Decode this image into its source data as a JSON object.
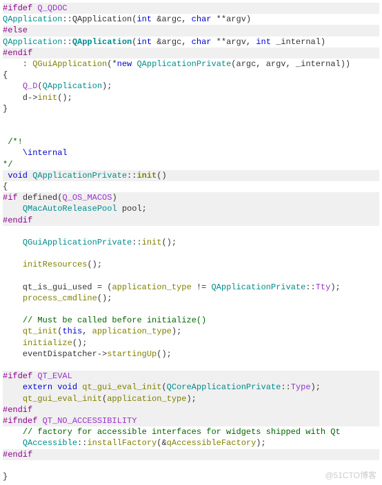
{
  "watermark": "@51CTO博客",
  "lines": [
    {
      "hl": true,
      "tokens": [
        {
          "t": "#ifdef ",
          "c": "kw-pre"
        },
        {
          "t": "Q_QDOC",
          "c": "kw-purple"
        }
      ]
    },
    {
      "tokens": [
        {
          "t": "QApplication",
          "c": "kw-teal"
        },
        {
          "t": "::"
        },
        {
          "t": "QApplication"
        },
        {
          "t": "("
        },
        {
          "t": "int",
          "c": "kw-blue"
        },
        {
          "t": " &argc, "
        },
        {
          "t": "char",
          "c": "kw-blue"
        },
        {
          "t": " **argv)"
        }
      ]
    },
    {
      "hl": true,
      "tokens": [
        {
          "t": "#else",
          "c": "kw-pre"
        }
      ]
    },
    {
      "tokens": [
        {
          "t": "QApplication",
          "c": "kw-teal"
        },
        {
          "t": "::"
        },
        {
          "t": "QApplication",
          "c": "kw-teal kw-bold"
        },
        {
          "t": "("
        },
        {
          "t": "int",
          "c": "kw-blue"
        },
        {
          "t": " &argc, "
        },
        {
          "t": "char",
          "c": "kw-blue"
        },
        {
          "t": " **argv, "
        },
        {
          "t": "int",
          "c": "kw-blue"
        },
        {
          "t": " _internal)"
        }
      ]
    },
    {
      "hl": true,
      "tokens": [
        {
          "t": "#endif",
          "c": "kw-pre"
        }
      ]
    },
    {
      "tokens": [
        {
          "t": "    : "
        },
        {
          "t": "QGuiApplication",
          "c": "kw-olive"
        },
        {
          "t": "(*"
        },
        {
          "t": "new",
          "c": "kw-blue"
        },
        {
          "t": " "
        },
        {
          "t": "QApplicationPrivate",
          "c": "kw-teal"
        },
        {
          "t": "(argc, argv, _internal))"
        }
      ]
    },
    {
      "tokens": [
        {
          "t": "{"
        }
      ]
    },
    {
      "tokens": [
        {
          "t": "    "
        },
        {
          "t": "Q_D",
          "c": "kw-purple"
        },
        {
          "t": "("
        },
        {
          "t": "QApplication",
          "c": "kw-teal"
        },
        {
          "t": ");"
        }
      ]
    },
    {
      "tokens": [
        {
          "t": "    d->"
        },
        {
          "t": "init",
          "c": "kw-olive"
        },
        {
          "t": "();"
        }
      ]
    },
    {
      "tokens": [
        {
          "t": "}"
        }
      ]
    },
    {
      "tokens": [
        {
          "t": " "
        }
      ]
    },
    {
      "tokens": [
        {
          "t": " "
        }
      ]
    },
    {
      "tokens": [
        {
          "t": " /*!",
          "c": "kw-green"
        }
      ]
    },
    {
      "tokens": [
        {
          "t": "    \\internal",
          "c": "kw-blue"
        }
      ]
    },
    {
      "tokens": [
        {
          "t": "*/",
          "c": "kw-green"
        }
      ]
    },
    {
      "hl": true,
      "tokens": [
        {
          "t": " "
        },
        {
          "t": "void",
          "c": "kw-blue"
        },
        {
          "t": " "
        },
        {
          "t": "QApplicationPrivate",
          "c": "kw-teal"
        },
        {
          "t": "::"
        },
        {
          "t": "init",
          "c": "kw-olive kw-bold"
        },
        {
          "t": "()"
        }
      ]
    },
    {
      "tokens": [
        {
          "t": "{"
        }
      ]
    },
    {
      "hl": true,
      "tokens": [
        {
          "t": "#if",
          "c": "kw-pre"
        },
        {
          "t": " "
        },
        {
          "t": "defined"
        },
        {
          "t": "("
        },
        {
          "t": "Q_OS_MACOS",
          "c": "kw-purple"
        },
        {
          "t": ")"
        }
      ]
    },
    {
      "hl": true,
      "tokens": [
        {
          "t": "    "
        },
        {
          "t": "QMacAutoReleasePool",
          "c": "kw-teal"
        },
        {
          "t": " pool;"
        }
      ]
    },
    {
      "hl": true,
      "tokens": [
        {
          "t": "#endif",
          "c": "kw-pre"
        }
      ]
    },
    {
      "tokens": [
        {
          "t": " "
        }
      ]
    },
    {
      "tokens": [
        {
          "t": "    "
        },
        {
          "t": "QGuiApplicationPrivate",
          "c": "kw-teal"
        },
        {
          "t": "::"
        },
        {
          "t": "init",
          "c": "kw-olive"
        },
        {
          "t": "();"
        }
      ]
    },
    {
      "tokens": [
        {
          "t": " "
        }
      ]
    },
    {
      "tokens": [
        {
          "t": "    "
        },
        {
          "t": "initResources",
          "c": "kw-olive"
        },
        {
          "t": "();"
        }
      ]
    },
    {
      "tokens": [
        {
          "t": " "
        }
      ]
    },
    {
      "tokens": [
        {
          "t": "    qt_is_gui_used = ("
        },
        {
          "t": "application_type",
          "c": "kw-olive"
        },
        {
          "t": " != "
        },
        {
          "t": "QApplicationPrivate",
          "c": "kw-teal"
        },
        {
          "t": "::"
        },
        {
          "t": "Tty",
          "c": "kw-purple"
        },
        {
          "t": ");"
        }
      ]
    },
    {
      "tokens": [
        {
          "t": "    "
        },
        {
          "t": "process_cmdline",
          "c": "kw-olive"
        },
        {
          "t": "();"
        }
      ]
    },
    {
      "tokens": [
        {
          "t": " "
        }
      ]
    },
    {
      "tokens": [
        {
          "t": "    "
        },
        {
          "t": "// Must be called before initialize()",
          "c": "kw-green"
        }
      ]
    },
    {
      "tokens": [
        {
          "t": "    "
        },
        {
          "t": "qt_init",
          "c": "kw-olive"
        },
        {
          "t": "("
        },
        {
          "t": "this",
          "c": "kw-blue"
        },
        {
          "t": ", "
        },
        {
          "t": "application_type",
          "c": "kw-olive"
        },
        {
          "t": ");"
        }
      ]
    },
    {
      "tokens": [
        {
          "t": "    "
        },
        {
          "t": "initialize",
          "c": "kw-olive"
        },
        {
          "t": "();"
        }
      ]
    },
    {
      "tokens": [
        {
          "t": "    eventDispatcher->"
        },
        {
          "t": "startingUp",
          "c": "kw-olive"
        },
        {
          "t": "();"
        }
      ]
    },
    {
      "tokens": [
        {
          "t": " "
        }
      ]
    },
    {
      "hl": true,
      "tokens": [
        {
          "t": "#ifdef ",
          "c": "kw-pre"
        },
        {
          "t": "QT_EVAL",
          "c": "kw-purple"
        }
      ]
    },
    {
      "hl": true,
      "tokens": [
        {
          "t": "    "
        },
        {
          "t": "extern",
          "c": "kw-blue"
        },
        {
          "t": " "
        },
        {
          "t": "void",
          "c": "kw-blue"
        },
        {
          "t": " "
        },
        {
          "t": "qt_gui_eval_init",
          "c": "kw-olive"
        },
        {
          "t": "("
        },
        {
          "t": "QCoreApplicationPrivate",
          "c": "kw-teal"
        },
        {
          "t": "::"
        },
        {
          "t": "Type",
          "c": "kw-purple"
        },
        {
          "t": ");"
        }
      ]
    },
    {
      "hl": true,
      "tokens": [
        {
          "t": "    "
        },
        {
          "t": "qt_gui_eval_init",
          "c": "kw-olive"
        },
        {
          "t": "("
        },
        {
          "t": "application_type",
          "c": "kw-olive"
        },
        {
          "t": ");"
        }
      ]
    },
    {
      "hl": true,
      "tokens": [
        {
          "t": "#endif",
          "c": "kw-pre"
        }
      ]
    },
    {
      "hl": true,
      "tokens": [
        {
          "t": "#ifndef ",
          "c": "kw-pre"
        },
        {
          "t": "QT_NO_ACCESSIBILITY",
          "c": "kw-purple"
        }
      ]
    },
    {
      "tokens": [
        {
          "t": "    "
        },
        {
          "t": "// factory for accessible interfaces for widgets shipped with Qt",
          "c": "kw-green"
        }
      ]
    },
    {
      "tokens": [
        {
          "t": "    "
        },
        {
          "t": "QAccessible",
          "c": "kw-teal"
        },
        {
          "t": "::"
        },
        {
          "t": "installFactory",
          "c": "kw-olive"
        },
        {
          "t": "(&"
        },
        {
          "t": "qAccessibleFactory",
          "c": "kw-olive"
        },
        {
          "t": ");"
        }
      ]
    },
    {
      "hl": true,
      "tokens": [
        {
          "t": "#endif",
          "c": "kw-pre"
        }
      ]
    },
    {
      "tokens": [
        {
          "t": " "
        }
      ]
    },
    {
      "tokens": [
        {
          "t": "}"
        }
      ]
    }
  ]
}
